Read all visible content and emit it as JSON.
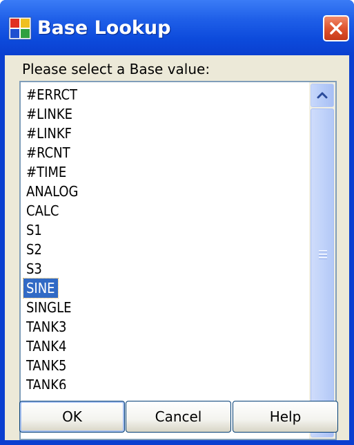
{
  "window": {
    "title": "Base Lookup",
    "icons": {
      "app": "app-icon",
      "close": "close-icon"
    }
  },
  "dialog": {
    "prompt": "Please select a Base value:",
    "list": {
      "items": [
        "#ERRCT",
        "#LINKE",
        "#LINKF",
        "#RCNT",
        "#TIME",
        "ANALOG",
        "CALC",
        "S1",
        "S2",
        "S3",
        "SINE",
        "SINGLE",
        "TANK3",
        "TANK4",
        "TANK5",
        "TANK6"
      ],
      "selected": "SINE",
      "selected_index": 10
    },
    "buttons": {
      "ok": "OK",
      "cancel": "Cancel",
      "help": "Help"
    }
  },
  "colors": {
    "title_bar": "#0a3fd0",
    "selection": "#316ac5",
    "dialog_bg": "#ece9d8",
    "close_button": "#e0542f"
  }
}
